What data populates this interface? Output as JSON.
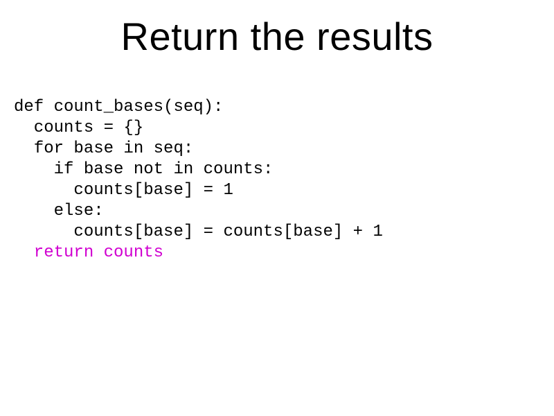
{
  "title": "Return the results",
  "code": {
    "l1": "def count_bases(seq):",
    "l2": "  counts = {}",
    "l3": "  for base in seq:",
    "l4": "    if base not in counts:",
    "l5": "      counts[base] = 1",
    "l6": "    else:",
    "l7": "      counts[base] = counts[base] + 1",
    "l8": "  return counts"
  }
}
